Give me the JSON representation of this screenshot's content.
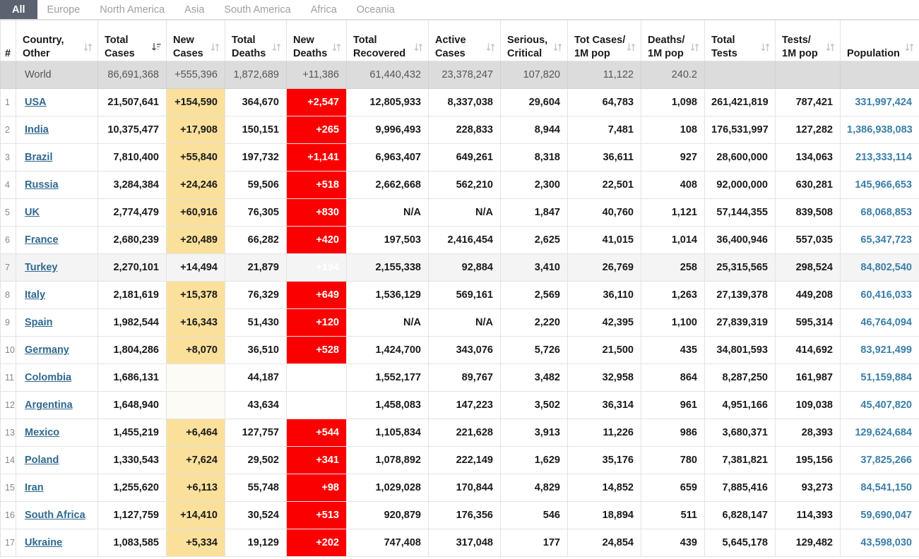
{
  "tabs": [
    {
      "label": "All",
      "active": true
    },
    {
      "label": "Europe",
      "active": false
    },
    {
      "label": "North America",
      "active": false
    },
    {
      "label": "Asia",
      "active": false
    },
    {
      "label": "South America",
      "active": false
    },
    {
      "label": "Africa",
      "active": false
    },
    {
      "label": "Oceania",
      "active": false
    }
  ],
  "colors": {
    "active_tab_bg": "#5b6370",
    "new_cases_bg": "#fbe09b",
    "new_deaths_bg": "#fb0000",
    "world_row_bg": "#dcdcdc",
    "link": "#30698f",
    "population": "#3b7fa8"
  },
  "table": {
    "columns": [
      {
        "key": "idx",
        "line1": "#",
        "line2": "",
        "sort": "none"
      },
      {
        "key": "country",
        "line1": "Country,",
        "line2": "Other",
        "sort": "both"
      },
      {
        "key": "total_cases",
        "line1": "Total",
        "line2": "Cases",
        "sort": "desc"
      },
      {
        "key": "new_cases",
        "line1": "New",
        "line2": "Cases",
        "sort": "both"
      },
      {
        "key": "total_deaths",
        "line1": "Total",
        "line2": "Deaths",
        "sort": "both"
      },
      {
        "key": "new_deaths",
        "line1": "New",
        "line2": "Deaths",
        "sort": "both"
      },
      {
        "key": "total_rec",
        "line1": "Total",
        "line2": "Recovered",
        "sort": "both"
      },
      {
        "key": "active",
        "line1": "Active",
        "line2": "Cases",
        "sort": "both"
      },
      {
        "key": "serious",
        "line1": "Serious,",
        "line2": "Critical",
        "sort": "both"
      },
      {
        "key": "cases_1m",
        "line1": "Tot Cases/",
        "line2": "1M pop",
        "sort": "both"
      },
      {
        "key": "deaths_1m",
        "line1": "Deaths/",
        "line2": "1M pop",
        "sort": "both"
      },
      {
        "key": "total_tests",
        "line1": "Total",
        "line2": "Tests",
        "sort": "both"
      },
      {
        "key": "tests_1m",
        "line1": "Tests/",
        "line2": "1M pop",
        "sort": "both"
      },
      {
        "key": "population",
        "line1": "",
        "line2": "Population",
        "sort": "both"
      }
    ],
    "world_row": {
      "idx": "",
      "country": "World",
      "total_cases": "86,691,368",
      "new_cases": "+555,396",
      "total_deaths": "1,872,689",
      "new_deaths": "+11,386",
      "total_rec": "61,440,432",
      "active": "23,378,247",
      "serious": "107,820",
      "cases_1m": "11,122",
      "deaths_1m": "240.2",
      "total_tests": "",
      "tests_1m": "",
      "population": ""
    },
    "rows": [
      {
        "idx": "1",
        "country": "USA",
        "total_cases": "21,507,641",
        "new_cases": "+154,590",
        "total_deaths": "364,670",
        "new_deaths": "+2,547",
        "total_rec": "12,805,933",
        "active": "8,337,038",
        "serious": "29,604",
        "cases_1m": "64,783",
        "deaths_1m": "1,098",
        "total_tests": "261,421,819",
        "tests_1m": "787,421",
        "population": "331,997,424",
        "hovered": false
      },
      {
        "idx": "2",
        "country": "India",
        "total_cases": "10,375,477",
        "new_cases": "+17,908",
        "total_deaths": "150,151",
        "new_deaths": "+265",
        "total_rec": "9,996,493",
        "active": "228,833",
        "serious": "8,944",
        "cases_1m": "7,481",
        "deaths_1m": "108",
        "total_tests": "176,531,997",
        "tests_1m": "127,282",
        "population": "1,386,938,083",
        "hovered": false
      },
      {
        "idx": "3",
        "country": "Brazil",
        "total_cases": "7,810,400",
        "new_cases": "+55,840",
        "total_deaths": "197,732",
        "new_deaths": "+1,141",
        "total_rec": "6,963,407",
        "active": "649,261",
        "serious": "8,318",
        "cases_1m": "36,611",
        "deaths_1m": "927",
        "total_tests": "28,600,000",
        "tests_1m": "134,063",
        "population": "213,333,114",
        "hovered": false
      },
      {
        "idx": "4",
        "country": "Russia",
        "total_cases": "3,284,384",
        "new_cases": "+24,246",
        "total_deaths": "59,506",
        "new_deaths": "+518",
        "total_rec": "2,662,668",
        "active": "562,210",
        "serious": "2,300",
        "cases_1m": "22,501",
        "deaths_1m": "408",
        "total_tests": "92,000,000",
        "tests_1m": "630,281",
        "population": "145,966,653",
        "hovered": false
      },
      {
        "idx": "5",
        "country": "UK",
        "total_cases": "2,774,479",
        "new_cases": "+60,916",
        "total_deaths": "76,305",
        "new_deaths": "+830",
        "total_rec": "N/A",
        "active": "N/A",
        "serious": "1,847",
        "cases_1m": "40,760",
        "deaths_1m": "1,121",
        "total_tests": "57,144,355",
        "tests_1m": "839,508",
        "population": "68,068,853",
        "hovered": false
      },
      {
        "idx": "6",
        "country": "France",
        "total_cases": "2,680,239",
        "new_cases": "+20,489",
        "total_deaths": "66,282",
        "new_deaths": "+420",
        "total_rec": "197,503",
        "active": "2,416,454",
        "serious": "2,625",
        "cases_1m": "41,015",
        "deaths_1m": "1,014",
        "total_tests": "36,400,946",
        "tests_1m": "557,035",
        "population": "65,347,723",
        "hovered": false
      },
      {
        "idx": "7",
        "country": "Turkey",
        "total_cases": "2,270,101",
        "new_cases": "+14,494",
        "total_deaths": "21,879",
        "new_deaths": "+194",
        "total_rec": "2,155,338",
        "active": "92,884",
        "serious": "3,410",
        "cases_1m": "26,769",
        "deaths_1m": "258",
        "total_tests": "25,315,565",
        "tests_1m": "298,524",
        "population": "84,802,540",
        "hovered": true
      },
      {
        "idx": "8",
        "country": "Italy",
        "total_cases": "2,181,619",
        "new_cases": "+15,378",
        "total_deaths": "76,329",
        "new_deaths": "+649",
        "total_rec": "1,536,129",
        "active": "569,161",
        "serious": "2,569",
        "cases_1m": "36,110",
        "deaths_1m": "1,263",
        "total_tests": "27,139,378",
        "tests_1m": "449,208",
        "population": "60,416,033",
        "hovered": false
      },
      {
        "idx": "9",
        "country": "Spain",
        "total_cases": "1,982,544",
        "new_cases": "+16,343",
        "total_deaths": "51,430",
        "new_deaths": "+120",
        "total_rec": "N/A",
        "active": "N/A",
        "serious": "2,220",
        "cases_1m": "42,395",
        "deaths_1m": "1,100",
        "total_tests": "27,839,319",
        "tests_1m": "595,314",
        "population": "46,764,094",
        "hovered": false
      },
      {
        "idx": "10",
        "country": "Germany",
        "total_cases": "1,804,286",
        "new_cases": "+8,070",
        "total_deaths": "36,510",
        "new_deaths": "+528",
        "total_rec": "1,424,700",
        "active": "343,076",
        "serious": "5,726",
        "cases_1m": "21,500",
        "deaths_1m": "435",
        "total_tests": "34,801,593",
        "tests_1m": "414,692",
        "population": "83,921,499",
        "hovered": false
      },
      {
        "idx": "11",
        "country": "Colombia",
        "total_cases": "1,686,131",
        "new_cases": "",
        "total_deaths": "44,187",
        "new_deaths": "",
        "total_rec": "1,552,177",
        "active": "89,767",
        "serious": "3,482",
        "cases_1m": "32,958",
        "deaths_1m": "864",
        "total_tests": "8,287,250",
        "tests_1m": "161,987",
        "population": "51,159,884",
        "hovered": false
      },
      {
        "idx": "12",
        "country": "Argentina",
        "total_cases": "1,648,940",
        "new_cases": "",
        "total_deaths": "43,634",
        "new_deaths": "",
        "total_rec": "1,458,083",
        "active": "147,223",
        "serious": "3,502",
        "cases_1m": "36,314",
        "deaths_1m": "961",
        "total_tests": "4,951,166",
        "tests_1m": "109,038",
        "population": "45,407,820",
        "hovered": false
      },
      {
        "idx": "13",
        "country": "Mexico",
        "total_cases": "1,455,219",
        "new_cases": "+6,464",
        "total_deaths": "127,757",
        "new_deaths": "+544",
        "total_rec": "1,105,834",
        "active": "221,628",
        "serious": "3,913",
        "cases_1m": "11,226",
        "deaths_1m": "986",
        "total_tests": "3,680,371",
        "tests_1m": "28,393",
        "population": "129,624,684",
        "hovered": false
      },
      {
        "idx": "14",
        "country": "Poland",
        "total_cases": "1,330,543",
        "new_cases": "+7,624",
        "total_deaths": "29,502",
        "new_deaths": "+341",
        "total_rec": "1,078,892",
        "active": "222,149",
        "serious": "1,629",
        "cases_1m": "35,176",
        "deaths_1m": "780",
        "total_tests": "7,381,821",
        "tests_1m": "195,156",
        "population": "37,825,266",
        "hovered": false
      },
      {
        "idx": "15",
        "country": "Iran",
        "total_cases": "1,255,620",
        "new_cases": "+6,113",
        "total_deaths": "55,748",
        "new_deaths": "+98",
        "total_rec": "1,029,028",
        "active": "170,844",
        "serious": "4,829",
        "cases_1m": "14,852",
        "deaths_1m": "659",
        "total_tests": "7,885,416",
        "tests_1m": "93,273",
        "population": "84,541,150",
        "hovered": false
      },
      {
        "idx": "16",
        "country": "South Africa",
        "total_cases": "1,127,759",
        "new_cases": "+14,410",
        "total_deaths": "30,524",
        "new_deaths": "+513",
        "total_rec": "920,879",
        "active": "176,356",
        "serious": "546",
        "cases_1m": "18,894",
        "deaths_1m": "511",
        "total_tests": "6,828,147",
        "tests_1m": "114,393",
        "population": "59,690,047",
        "hovered": false
      },
      {
        "idx": "17",
        "country": "Ukraine",
        "total_cases": "1,083,585",
        "new_cases": "+5,334",
        "total_deaths": "19,129",
        "new_deaths": "+202",
        "total_rec": "747,408",
        "active": "317,048",
        "serious": "177",
        "cases_1m": "24,854",
        "deaths_1m": "439",
        "total_tests": "5,645,178",
        "tests_1m": "129,482",
        "population": "43,598,030",
        "hovered": false
      }
    ]
  }
}
